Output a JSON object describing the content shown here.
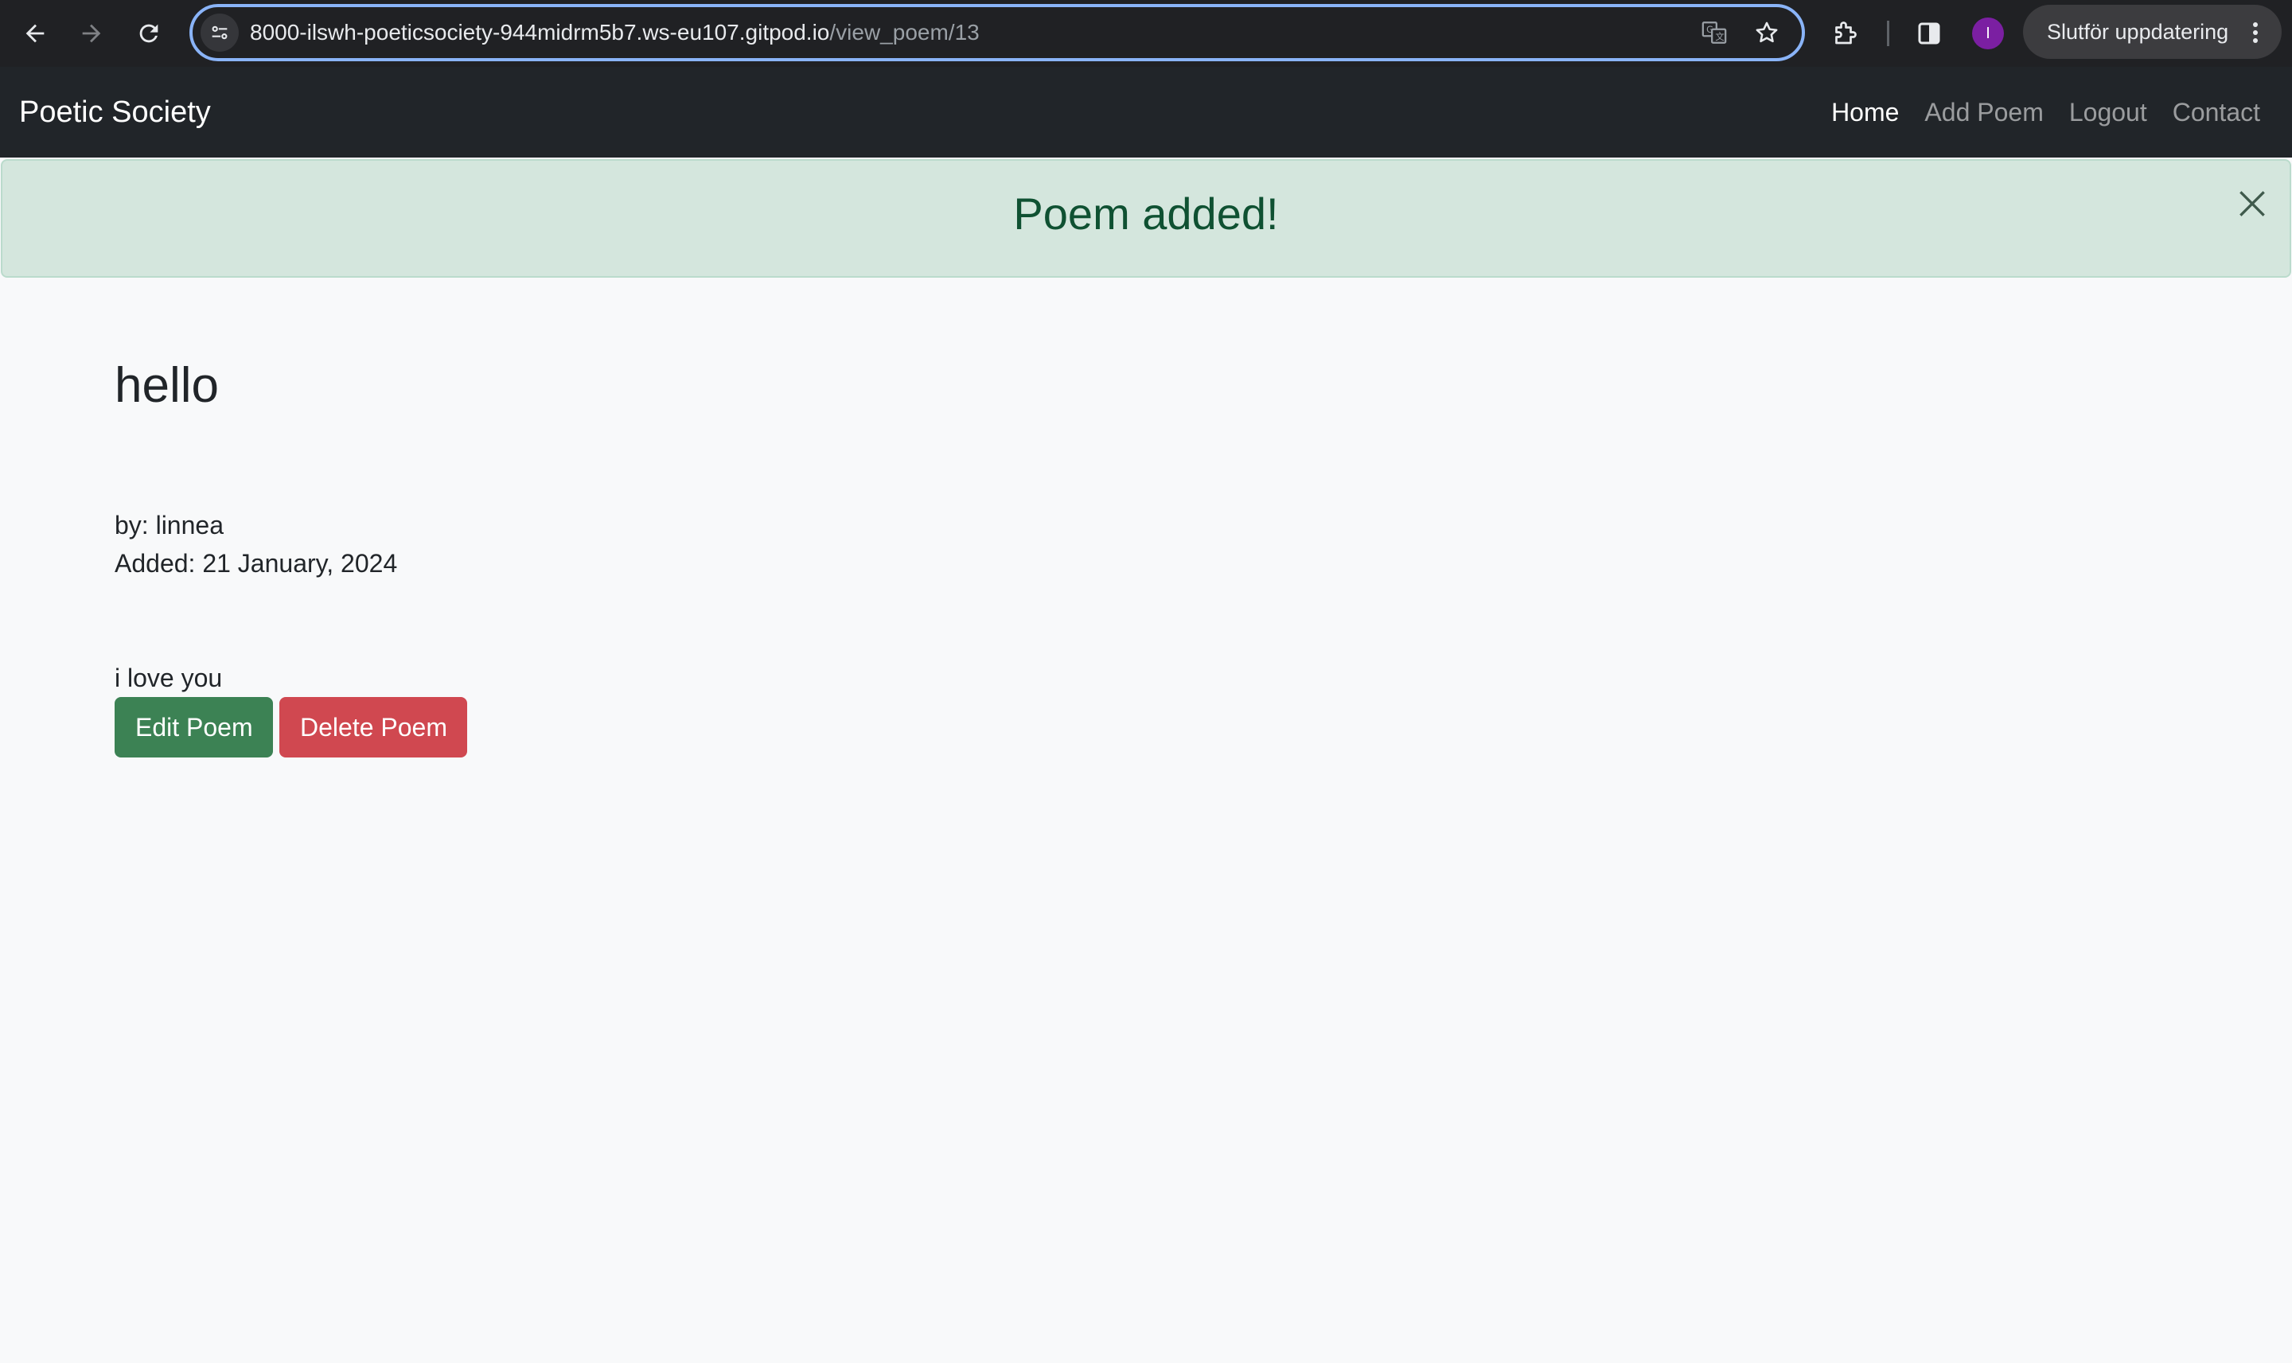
{
  "browser": {
    "url_host": "8000-ilswh-poeticsociety-944midrm5b7.ws-eu107.gitpod.io",
    "url_path": "/view_poem/13",
    "profile_initial": "I",
    "update_label": "Slutför uppdatering",
    "icons": [
      "back-arrow-icon",
      "forward-arrow-icon",
      "reload-icon",
      "site-settings-icon",
      "translate-icon",
      "star-icon",
      "extensions-icon",
      "side-panel-icon",
      "kebab-menu-icon"
    ]
  },
  "navbar": {
    "brand": "Poetic Society",
    "links": [
      {
        "label": "Home",
        "active": true
      },
      {
        "label": "Add Poem",
        "active": false
      },
      {
        "label": "Logout",
        "active": false
      },
      {
        "label": "Contact",
        "active": false
      }
    ]
  },
  "alert": {
    "message": "Poem added!",
    "color_bg": "#d4e6dd",
    "color_text": "#0f5132"
  },
  "poem": {
    "title": "hello",
    "author_line": "by: linnea",
    "added_line": "Added: 21 January, 2024",
    "body": "i love you"
  },
  "actions": {
    "edit_label": "Edit Poem",
    "delete_label": "Delete Poem",
    "edit_color": "#3c8254",
    "delete_color": "#d04850"
  }
}
